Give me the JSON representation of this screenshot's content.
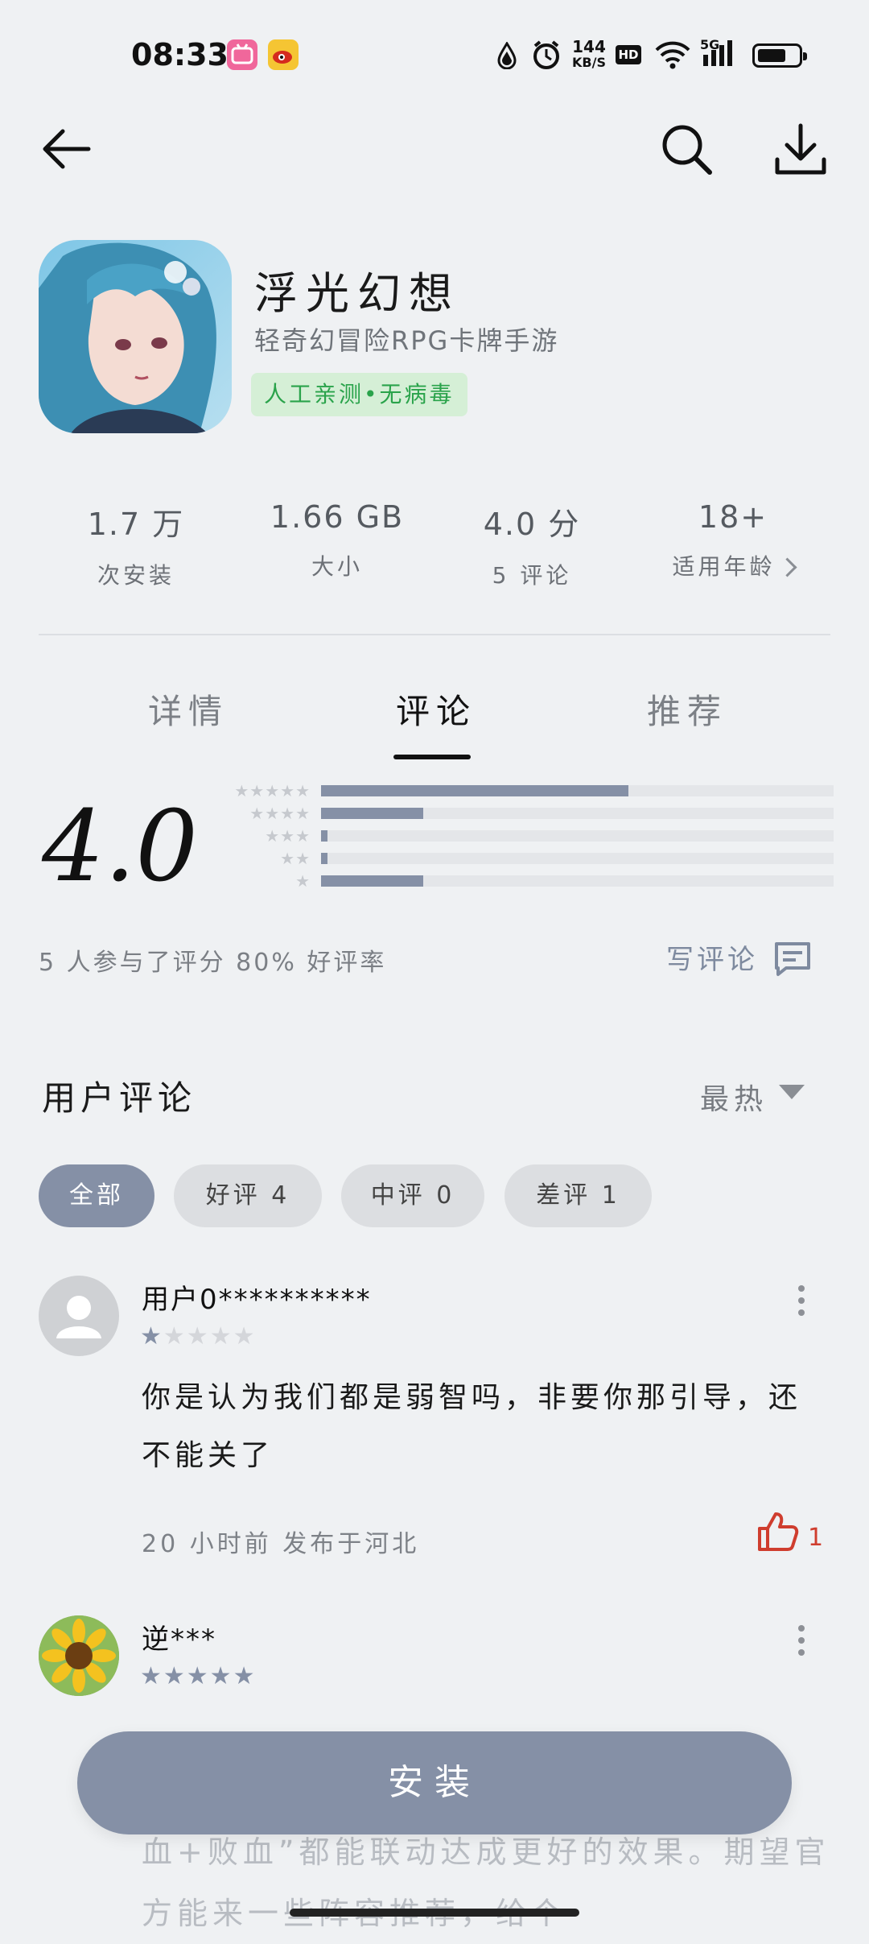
{
  "status_bar": {
    "time": "08:33",
    "net_speed_value": "144",
    "net_speed_unit": "KB/S",
    "hd": "HD",
    "network": "5G",
    "app_icons": [
      "bilibili-icon",
      "weibo-icon"
    ],
    "status_icons": [
      "water-drop-icon",
      "alarm-icon",
      "wifi-icon",
      "signal-icon",
      "battery-icon"
    ]
  },
  "toolbar": {
    "back": "back-arrow-icon",
    "search": "search-icon",
    "download": "download-icon"
  },
  "app": {
    "name": "浮光幻想",
    "subtitle": "轻奇幻冒险RPG卡牌手游",
    "badge": "人工亲测•无病毒"
  },
  "stats": [
    {
      "value": "1.7 万",
      "label": "次安装"
    },
    {
      "value": "1.66 GB",
      "label": "大小"
    },
    {
      "value": "4.0 分",
      "label": "5 评论"
    },
    {
      "value": "18+",
      "label": "适用年龄"
    }
  ],
  "tabs": [
    {
      "label": "详情",
      "active": false
    },
    {
      "label": "评论",
      "active": true
    },
    {
      "label": "推荐",
      "active": false
    }
  ],
  "rating": {
    "score": "4.0",
    "distribution_fraction": [
      0.6,
      0.2,
      0.01,
      0.01,
      0.2
    ],
    "summary": "5 人参与了评分  80% 好评率",
    "write_review": "写评论"
  },
  "user_reviews": {
    "title": "用户评论",
    "sort": "最热",
    "filters": [
      "全部",
      "好评 4",
      "中评 0",
      "差评 1"
    ]
  },
  "reviews": [
    {
      "user": "用户0**********",
      "stars": 1,
      "text": "你是认为我们都是弱智吗，非要你那引导，还不能关了",
      "meta": "20 小时前 发布于河北",
      "likes": "1"
    },
    {
      "user": "逆***",
      "stars": 5,
      "text": "血+败血”都能联动达成更好的效果。期望官方能来一些阵容推荐，给个"
    }
  ],
  "install_button": "安装",
  "colors": {
    "accent": "#8590a6",
    "badge_bg": "#d5efd6",
    "badge_text": "#2aa34b",
    "like": "#cf3d2e",
    "background": "#eff1f3"
  }
}
